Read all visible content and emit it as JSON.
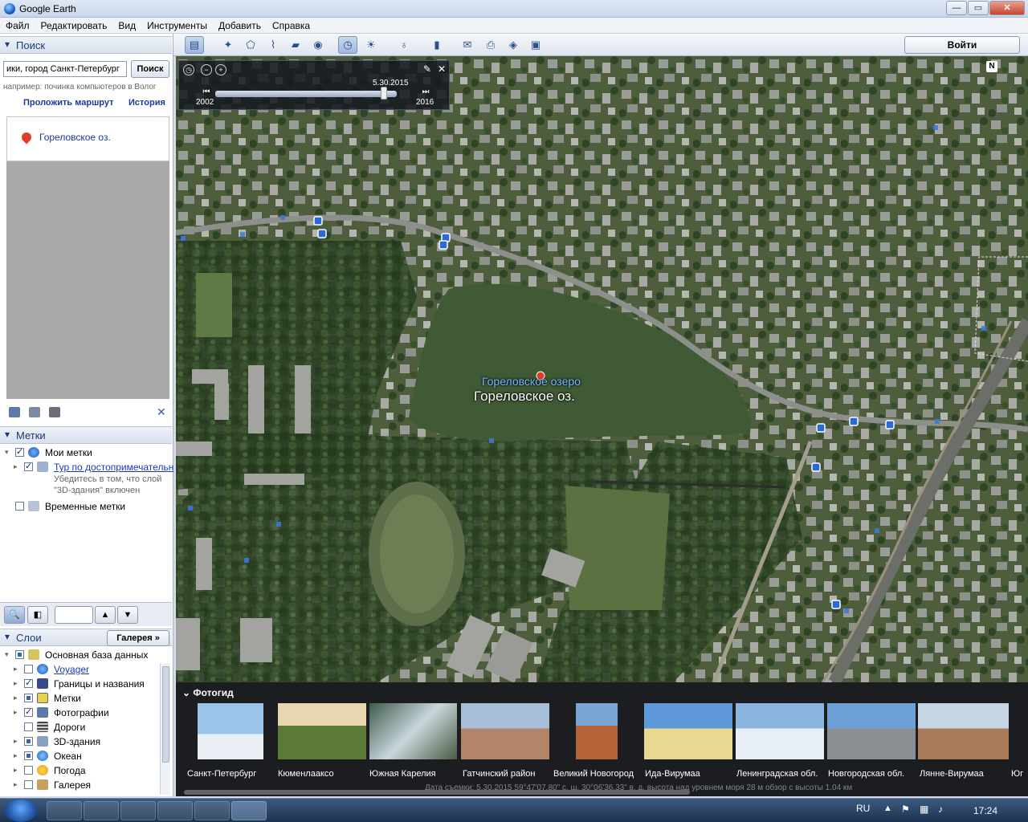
{
  "window": {
    "title": "Google Earth",
    "minimize_glyph": "—",
    "maximize_glyph": "▭",
    "close_glyph": "✕"
  },
  "menu": [
    "Файл",
    "Редактировать",
    "Вид",
    "Инструменты",
    "Добавить",
    "Справка"
  ],
  "search": {
    "header": "Поиск",
    "value": "ики, город Санкт-Петербург",
    "button": "Поиск",
    "hint": "например: починка компьютеров в Волог",
    "route_link": "Проложить маршрут",
    "history_link": "История",
    "result": "Гореловское оз."
  },
  "places": {
    "header": "Метки",
    "my_places": "Мои метки",
    "tour_link": "Тур по достопримечательн",
    "tour_note_1": "Убедитесь в том, что слой",
    "tour_note_2": "\"3D-здания\" включен",
    "temporary": "Временные метки"
  },
  "layers": {
    "header": "Слои",
    "gallery_button": "Галерея",
    "gallery_glyph": "»",
    "items": [
      {
        "label": "Основная база данных",
        "link": false
      },
      {
        "label": "Voyager",
        "link": true
      },
      {
        "label": "Границы и названия",
        "link": false
      },
      {
        "label": "Метки",
        "link": false
      },
      {
        "label": "Фотографии",
        "link": false
      },
      {
        "label": "Дороги",
        "link": false
      },
      {
        "label": "3D-здания",
        "link": false
      },
      {
        "label": "Океан",
        "link": false
      },
      {
        "label": "Погода",
        "link": false
      },
      {
        "label": "Галерея",
        "link": false
      }
    ]
  },
  "toolbar": {
    "login": "Войти"
  },
  "timeslider": {
    "date": "5.30.2015",
    "start_year": "2002",
    "end_year": "2016",
    "position": 0.93
  },
  "map": {
    "lake_label_blue": "Гореловское озеро",
    "lake_label_white": "Гореловское оз.",
    "compass": "N"
  },
  "photoguide": {
    "header": "Фотогид",
    "photos": [
      "Санкт-Петербург",
      "Кюменлааксо",
      "Южная Карелия",
      "Гатчинский район",
      "Великий Новогород",
      "Ида-Вирумаа",
      "Ленинградская обл.",
      "Новгородская обл.",
      "Лянне-Вирумаа",
      "Юг"
    ],
    "status": "Дата съемки: 5.30.2015    59°47'07.80\" с. ш.   30°06'36.33\" в. д.   высота над уровнем моря    28 м     обзор с высоты   1.04 км"
  },
  "taskbar": {
    "lang": "RU",
    "clock": "17:24"
  },
  "colors": {
    "accent": "#1b3a9a",
    "lake": "#3f5a34",
    "pin": "#e23b2b"
  }
}
